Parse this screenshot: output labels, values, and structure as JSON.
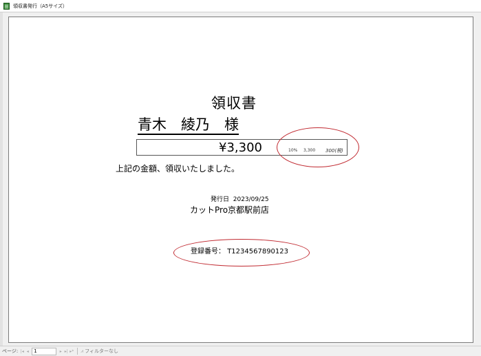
{
  "window": {
    "title": "領収書発行（A5サイズ）"
  },
  "receipt": {
    "title": "領収書",
    "customer": "青木　綾乃　様",
    "amount": "¥3,300",
    "tax": {
      "rate": "10%",
      "base": "3,300",
      "amount": "300(税)"
    },
    "received_text": "上記の金額、領収いたしました。",
    "issue_date_label": "発行日",
    "issue_date": "2023/09/25",
    "store_name": "カットPro京都駅前店",
    "registration_label": "登録番号：",
    "registration_number": "T1234567890123"
  },
  "statusbar": {
    "page_label": "ページ:",
    "first": "|◂",
    "prev": "◂",
    "page_value": "1",
    "next": "▸",
    "last": "▸|",
    "new": "▸*",
    "filter_icon": "⩘",
    "filter_label": "フィルターなし"
  },
  "colors": {
    "annotation_ellipse": "#c0282f"
  }
}
